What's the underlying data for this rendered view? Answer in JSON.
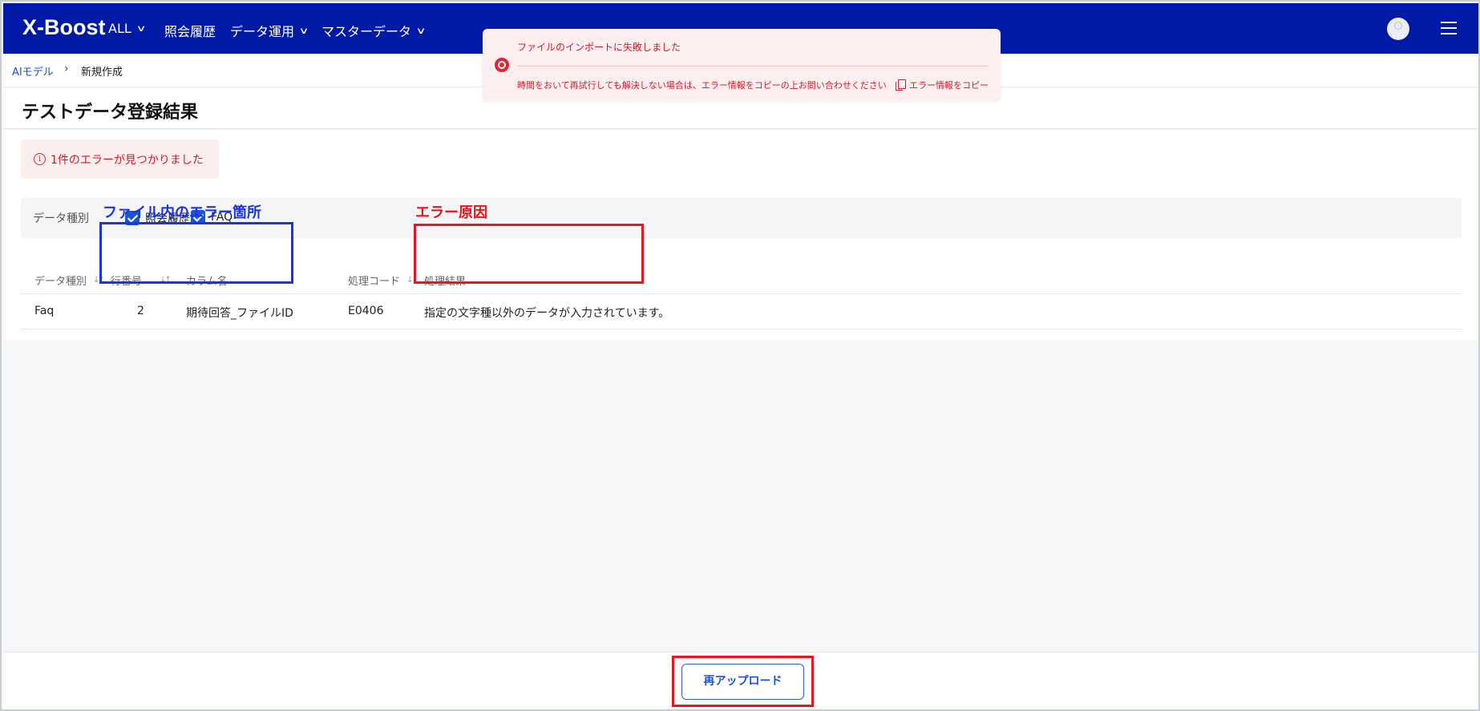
{
  "header": {
    "logo": "X-Boost",
    "nav": [
      {
        "label": "ALL",
        "has_dropdown": true
      },
      {
        "label": "照会履歴",
        "has_dropdown": false
      },
      {
        "label": "データ運用",
        "has_dropdown": true
      },
      {
        "label": "マスターデータ",
        "has_dropdown": true
      }
    ],
    "brand_color": "#001aa8"
  },
  "breadcrumb": {
    "parent": "AIモデル",
    "current": "新規作成"
  },
  "page_title": "テストデータ登録結果",
  "error_banner": "1件のエラーが見つかりました",
  "filter": {
    "label": "データ種別",
    "options": [
      {
        "label": "照会履歴",
        "checked": true
      },
      {
        "label": "FAQ",
        "checked": true
      }
    ]
  },
  "annotations": {
    "file_error_location": "ファイル内のエラー箇所",
    "error_cause": "エラー原因"
  },
  "table": {
    "columns": [
      "データ種別",
      "行番号",
      "カラム名",
      "処理コード",
      "処理結果"
    ],
    "rows": [
      {
        "data_type": "Faq",
        "row_no": "2",
        "column_name": "期待回答_ファイルID",
        "code": "E0406",
        "result": "指定の文字種以外のデータが入力されています。"
      }
    ]
  },
  "footer": {
    "reupload_label": "再アップロード"
  },
  "toast": {
    "title": "ファイルのインポートに失敗しました",
    "message": "時間をおいて再試行しても解決しない場合は、エラー情報をコピーの上お問い合わせください",
    "copy_label": "エラー情報をコピー"
  }
}
